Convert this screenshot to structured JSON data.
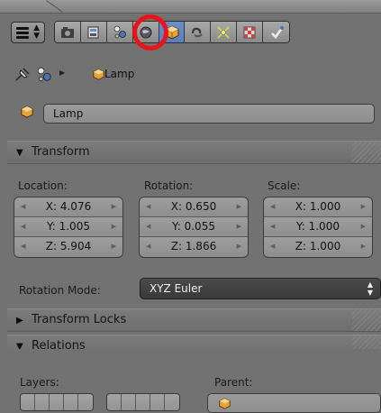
{
  "tab_icons": [
    "render-icon",
    "render-layers-icon",
    "scene-icon",
    "world-icon",
    "object-icon",
    "constraints-icon",
    "modifiers-icon",
    "texture-icon",
    "data-icon"
  ],
  "breadcrumb": {
    "item_label": "Lamp"
  },
  "object_name": {
    "value": "Lamp"
  },
  "transform": {
    "header": "Transform",
    "location": {
      "label": "Location:",
      "x": "X: 4.076",
      "y": "Y: 1.005",
      "z": "Z: 5.904"
    },
    "rotation": {
      "label": "Rotation:",
      "x": "X: 0.650",
      "y": "Y: 0.055",
      "z": "Z: 1.866"
    },
    "scale": {
      "label": "Scale:",
      "x": "X: 1.000",
      "y": "Y: 1.000",
      "z": "Z: 1.000"
    },
    "rotation_mode": {
      "label": "Rotation Mode:",
      "value": "XYZ Euler"
    }
  },
  "transform_locks": {
    "header": "Transform Locks"
  },
  "relations": {
    "header": "Relations",
    "layers_label": "Layers:",
    "parent_label": "Parent:"
  },
  "colors": {
    "accent": "#5680c2",
    "highlight": "#e8151c",
    "object": "#e8a23a"
  }
}
